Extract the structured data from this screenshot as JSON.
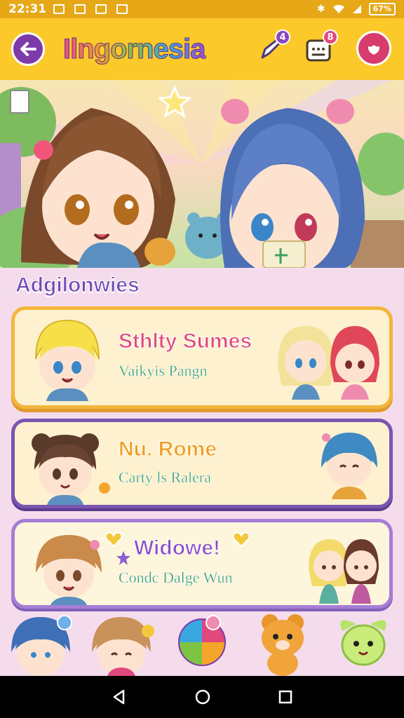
{
  "status_bar": {
    "time": "22:31",
    "battery": "67%"
  },
  "header": {
    "title": "Ilngornesia",
    "notes_badge": "4",
    "calendar_badge": "8"
  },
  "section": {
    "title": "Adgilonwies"
  },
  "cards": [
    {
      "title": "Sthlty Sumes",
      "subtitle": "Vaikyis Pangn"
    },
    {
      "title": "Nu. Rome",
      "subtitle": "Carty ls Ralera"
    },
    {
      "title": "Widowe!",
      "subtitle": "Condc Dalge Wun"
    }
  ],
  "colors": {
    "status_bar": "#e7a817",
    "app_bar": "#fbc92a",
    "accent_purple": "#7d3aa8",
    "background": "#f5dced"
  }
}
